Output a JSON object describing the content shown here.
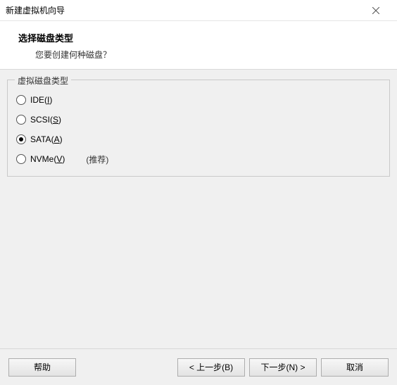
{
  "window": {
    "title": "新建虚拟机向导"
  },
  "header": {
    "title": "选择磁盘类型",
    "subtitle": "您要创建何种磁盘？"
  },
  "group": {
    "legend": "虚拟磁盘类型",
    "options": [
      {
        "label": "IDE",
        "accel": "I",
        "extra": "",
        "selected": false
      },
      {
        "label": "SCSI",
        "accel": "S",
        "extra": "",
        "selected": false
      },
      {
        "label": "SATA",
        "accel": "A",
        "extra": "",
        "selected": true
      },
      {
        "label": "NVMe",
        "accel": "V",
        "extra": "(推荐)",
        "selected": false
      }
    ]
  },
  "footer": {
    "help": "帮助",
    "back": "< 上一步(B)",
    "next": "下一步(N) >",
    "cancel": "取消"
  }
}
